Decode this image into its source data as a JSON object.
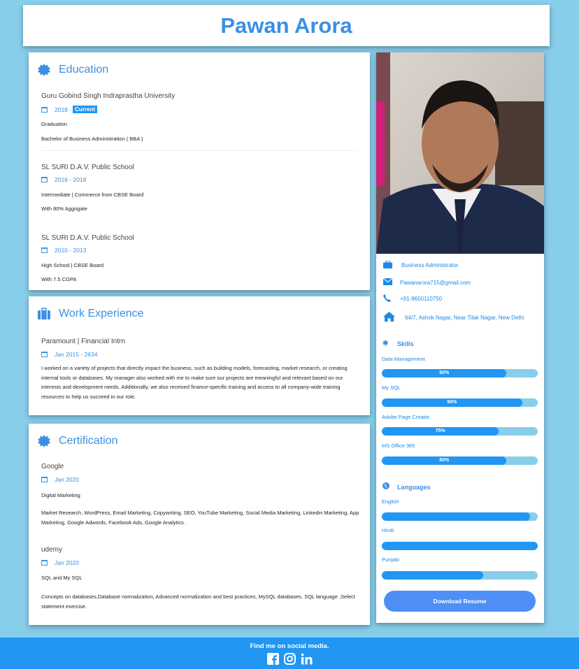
{
  "header": {
    "name": "Pawan Arora"
  },
  "education": {
    "title": "Education",
    "items": [
      {
        "school": "Guru Gobind Singh Indraprastha University",
        "date": "2018 -",
        "badge": "Current",
        "line1": "Graduation",
        "line2": "Bachelor of Business Administration ( BBA )"
      },
      {
        "school": "SL SURI D.A.V. Public School",
        "date": "2016 - 2018",
        "line1": "Intermediate | Commerce from CBSE Board",
        "line2": "With 80% Aggrigate"
      },
      {
        "school": "SL SURI D.A.V. Public School",
        "date": "2010 - 2013",
        "line1": "High School | CBSE Board",
        "line2": "With 7.5 CGPA"
      }
    ]
  },
  "work": {
    "title": "Work Experience",
    "items": [
      {
        "company": "Paramount | Financial Intrn",
        "date": "Jan 2015 - 2634",
        "description": "I worked on a variety of projects that directly impact the business, such as building models, forecasting, market research, or creating internal tools or databases. My manager also worked with me to make sure our projects are meaningful and relevant based on our interests and development needs. Additionally, we also received finance-specific training and access to all company-wide training resources to help us succeed in our role."
      }
    ]
  },
  "certification": {
    "title": "Certification",
    "items": [
      {
        "provider": "Google",
        "date": "Jan 2020",
        "course": "Digital Marketing",
        "description": "Market Research, WordPress, Email Marketing, Copywriting, SEO, YouTube Marketing, Social Media Marketing, Linkedin Marketing, App Marketing, Google Adwords, Facebook Ads, Google Analytics ."
      },
      {
        "provider": "udemy",
        "date": "Jan 2020",
        "course": "SQL and My SQL",
        "description": "Concepts on databases,Database normalization, Advanced normalization and best practices, MySQL databases. SQL language ,Select statement exercise."
      }
    ]
  },
  "sidebar": {
    "contacts": {
      "role": "Business Administrator",
      "email": "Pawanarora715@gmail.com",
      "phone": "+91-9650110750",
      "address": "64/7, Ashok Nagar, Near Tilak Nagar, New Delhi"
    },
    "skills_title": "Skills",
    "skills": [
      {
        "name": "Data Management",
        "level": 80,
        "label": "80%"
      },
      {
        "name": "My SQL",
        "level": 90,
        "label": "90%"
      },
      {
        "name": "Adobe Page Creator",
        "level": 75,
        "label": "75%"
      },
      {
        "name": "MS Office 365",
        "level": 80,
        "label": "80%"
      }
    ],
    "languages_title": "Languages",
    "languages": [
      {
        "name": "English",
        "level": 95
      },
      {
        "name": "Hindi",
        "level": 100
      },
      {
        "name": "Punjabi",
        "level": 65
      }
    ],
    "download_label": "Download Resume"
  },
  "footer": {
    "text": "Find me on social media."
  },
  "colors": {
    "accent": "#3b8fe4",
    "background": "#87ceeb",
    "bar": "#2196f3"
  },
  "icons": [
    "badge-icon",
    "briefcase-icon",
    "calendar-icon",
    "envelope-icon",
    "phone-icon",
    "home-icon",
    "asterisk-icon",
    "globe-icon",
    "facebook-icon",
    "instagram-icon",
    "linkedin-icon"
  ]
}
